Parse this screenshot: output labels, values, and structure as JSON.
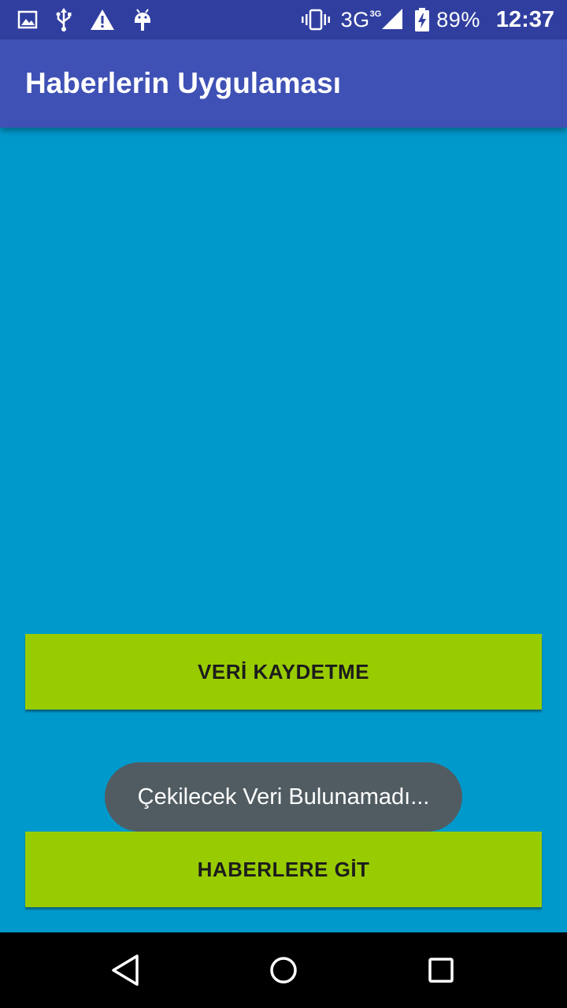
{
  "status_bar": {
    "battery": "89%",
    "time": "12:37",
    "network": "3G",
    "network_small": "3G",
    "icons": [
      "image-icon",
      "usb-icon",
      "warning-icon",
      "android-icon",
      "vibrate-icon",
      "signal-icon",
      "battery-charging-icon"
    ]
  },
  "app_bar": {
    "title": "Haberlerin Uygulaması"
  },
  "content": {
    "save_button_label": "VERİ KAYDETME",
    "news_button_label": "HABERLERE GİT"
  },
  "toast": {
    "message": "Çekilecek Veri Bulunamadı..."
  },
  "nav_bar": {
    "icons": [
      "back-icon",
      "home-icon",
      "recents-icon"
    ]
  },
  "colors": {
    "status_bar": "#303f9f",
    "app_bar": "#3f51b5",
    "background": "#0099cc",
    "button": "#99cc00",
    "toast": "#505c62",
    "nav_bar": "#000000"
  }
}
